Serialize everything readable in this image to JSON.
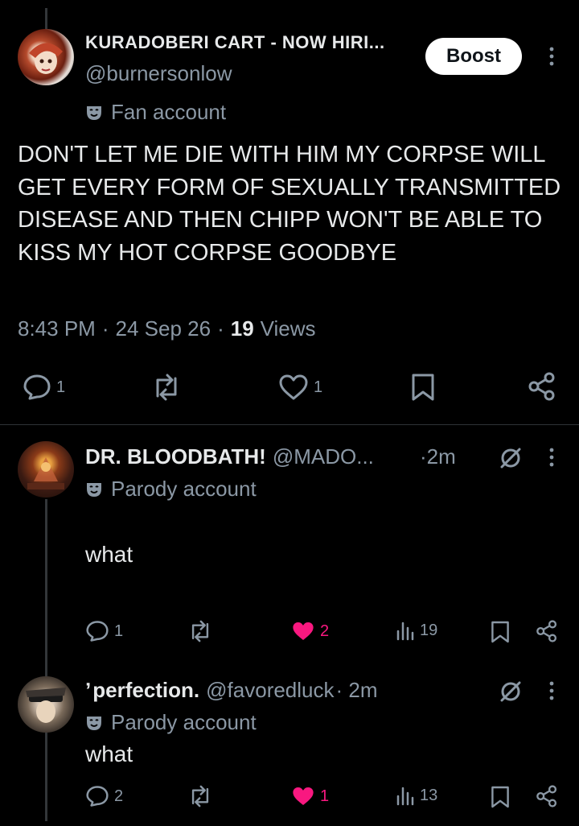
{
  "main_post": {
    "display_name": "KURADOBERI CART - NOW HIRI...",
    "handle": "@burnersonlow",
    "label": "Fan account",
    "boost_label": "Boost",
    "text": "DON'T LET ME DIE WITH HIM MY CORPSE WILL GET EVERY FORM OF SEXUALLY TRANSMITTED DISEASE AND THEN CHIPP WON'T BE ABLE TO KISS MY HOT CORPSE GOODBYE",
    "time": "8:43 PM",
    "date": "24 Sep 26",
    "views_count": "19",
    "views_label": "Views",
    "reply_count": "1",
    "like_count": "1"
  },
  "replies": [
    {
      "display_name": "DR. BLOODBATH!",
      "handle": "@MADO...",
      "time": "·2m",
      "label": "Parody account",
      "text": "what",
      "reply_count": "1",
      "like_count": "2",
      "view_count": "19"
    },
    {
      "prefix": "ʼ",
      "display_name": "perfection.",
      "handle": "@favoredluck",
      "time": "· 2m",
      "label": "Parody account",
      "text": "what",
      "reply_count": "2",
      "like_count": "1",
      "view_count": "13"
    }
  ],
  "colors": {
    "background": "#000000",
    "text": "#e7e9ea",
    "muted": "#8b98a5",
    "like_pink": "#f91880",
    "boost_bg": "#ffffff"
  }
}
